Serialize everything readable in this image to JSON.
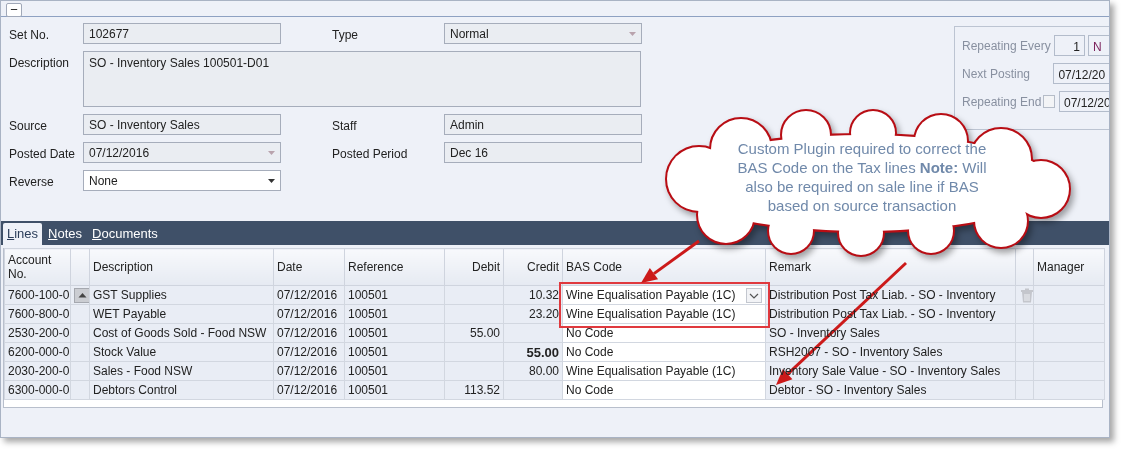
{
  "collapse_button": "−",
  "form": {
    "rows": [
      {
        "fields": [
          {
            "label": "Set No.",
            "kind": "text",
            "value": "102677",
            "disabled": true
          },
          {
            "label": "Type",
            "kind": "select",
            "value": "Normal",
            "disabled": true
          }
        ]
      },
      {
        "fields": [
          {
            "label": "Description",
            "kind": "textarea",
            "value": "SO - Inventory Sales 100501-D01",
            "disabled": true
          }
        ]
      },
      {
        "fields": [
          {
            "label": "Source",
            "kind": "link",
            "value": "SO - Inventory Sales",
            "disabled": true
          },
          {
            "label": "Staff",
            "kind": "text",
            "value": "Admin",
            "disabled": true
          }
        ]
      },
      {
        "fields": [
          {
            "label": "Posted Date",
            "kind": "select",
            "value": "07/12/2016",
            "disabled": true
          },
          {
            "label": "Posted Period",
            "kind": "text",
            "value": "Dec 16",
            "disabled": true
          }
        ]
      },
      {
        "fields": [
          {
            "label": "Reverse",
            "kind": "select",
            "value": "None",
            "disabled": false
          }
        ]
      }
    ]
  },
  "repeat_panel": {
    "disabled": true,
    "rows": [
      {
        "label": "Repeating Every",
        "kind": "number",
        "value": "1",
        "unit": "N"
      },
      {
        "label": "Next Posting",
        "kind": "date",
        "value": "07/12/20"
      },
      {
        "label": "Repeating End",
        "kind": "checkdate",
        "checked": false,
        "value": "07/12/20"
      }
    ]
  },
  "tabs": [
    {
      "label": "Lines",
      "selected": true
    },
    {
      "label": "Notes",
      "selected": false
    },
    {
      "label": "Documents",
      "selected": false
    }
  ],
  "table": {
    "columns": [
      {
        "kind": "account",
        "label": "Account No."
      },
      {
        "kind": "handle"
      },
      {
        "kind": "text",
        "label": "Description"
      },
      {
        "kind": "text",
        "label": "Date"
      },
      {
        "kind": "text",
        "label": "Reference"
      },
      {
        "kind": "amount",
        "label": "Debit"
      },
      {
        "kind": "amount",
        "label": "Credit"
      },
      {
        "kind": "code",
        "label": "BAS Code"
      },
      {
        "kind": "text",
        "label": "Remark"
      },
      {
        "kind": "action"
      },
      {
        "kind": "text",
        "label": "Manager"
      }
    ],
    "rows": [
      {
        "account": "7600-100-0",
        "description": "GST Supplies",
        "date": "07/12/2016",
        "reference": "100501",
        "credit": "10.32",
        "bas_code": "Wine Equalisation Payable (1C)",
        "remark": "Distribution Post Tax Liab. - SO - Inventory",
        "current": true,
        "credit_bold": false,
        "annotated": true
      },
      {
        "account": "7600-800-0",
        "description": "WET Payable",
        "date": "07/12/2016",
        "reference": "100501",
        "credit": "23.20",
        "bas_code": "Wine Equalisation Payable (1C)",
        "remark": "Distribution Post Tax Liab. - SO - Inventory",
        "current": false,
        "credit_bold": false,
        "annotated": true
      },
      {
        "account": "2530-200-0",
        "description": "Cost of Goods Sold - Food  NSW",
        "date": "07/12/2016",
        "reference": "100501",
        "debit": "55.00",
        "bas_code": "No Code",
        "remark": "SO - Inventory Sales",
        "current": false,
        "annotated": false
      },
      {
        "account": "6200-000-0",
        "description": "Stock Value",
        "date": "07/12/2016",
        "reference": "100501",
        "credit": "55.00",
        "bas_code": "No Code",
        "remark": "RSH2007 - SO - Inventory Sales",
        "current": false,
        "credit_bold": true,
        "annotated": false
      },
      {
        "account": "2030-200-0",
        "description": "Sales - Food NSW",
        "date": "07/12/2016",
        "reference": "100501",
        "credit": "80.00",
        "bas_code": "Wine Equalisation Payable (1C)",
        "remark": "Inventory Sale Value - SO - Inventory Sales",
        "current": false,
        "credit_bold": false,
        "annotated": false
      },
      {
        "account": "6300-000-0",
        "description": "Debtors Control",
        "date": "07/12/2016",
        "reference": "100501",
        "debit": "113.52",
        "bas_code": "No Code",
        "remark": "Debtor - SO - Inventory Sales",
        "current": false,
        "annotated": false
      }
    ]
  },
  "callout": {
    "text": "Custom Plugin required to correct the BAS Code on the  Tax lines **Note:** Will also be required on sale line if BAS based on source transaction"
  }
}
